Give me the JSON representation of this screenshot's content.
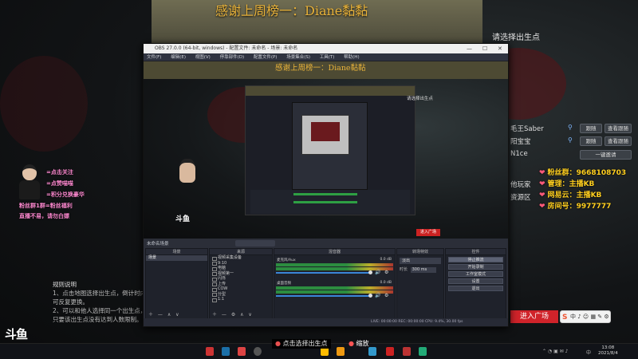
{
  "stream": {
    "banner_title": "感谢上周榜一：Diane黏黏",
    "choose_spawn_hint": "请选择出生点",
    "enter_plaza": "进入广场",
    "platform_logo": "斗鱼",
    "bottom_toast": "点击选择出生点",
    "bottom_toast_2": "缩放"
  },
  "right_panel": {
    "players": [
      {
        "name": "毛王Saber",
        "left_btn": "跟随",
        "right_btn": "查看跟随"
      },
      {
        "name": "阳宝宝",
        "left_btn": "跟随",
        "right_btn": "查看跟随"
      },
      {
        "name": "N1ce",
        "left_btn": "",
        "right_btn": "一键邀请"
      },
      {
        "name": "他玩家",
        "left_btn": "",
        "right_btn": ""
      },
      {
        "name": "资源区",
        "left_btn": "",
        "right_btn": ""
      }
    ],
    "info": [
      {
        "label": "粉丝群：",
        "value": "9668108703"
      },
      {
        "label": "管理：",
        "value": "主播KB"
      },
      {
        "label": "网易云：",
        "value": "主播KB"
      },
      {
        "label": "房间号：",
        "value": "9977777"
      }
    ]
  },
  "left_panel": {
    "lines": [
      "=点击关注",
      "=点赞喵喵",
      "=积分兑换豪华",
      "粉丝群1群=粉丝福利",
      "直播不易，请勿白嫖"
    ],
    "rules_title": "规则说明",
    "rules": [
      "1、点击地图选择出生点，倒计时内",
      "可反复更换。",
      "2、可以和他人选择同一个出生点，",
      "只要该出生点没有达到人数限制。"
    ]
  },
  "obs": {
    "title": "OBS 27.0.0 (64-bit, windows) - 配置文件: 未命名 - 场景: 未命名",
    "menu": [
      "文件(F)",
      "编辑(E)",
      "视图(V)",
      "停靠部件(D)",
      "配置文件(P)",
      "场景集合(S)",
      "工具(T)",
      "帮助(H)"
    ],
    "preview_banner": "感谢上周榜一：Diane黏黏",
    "preview_hint": "请选择出生点",
    "preview_enter": "进入广场",
    "dock_title": "未命名场景",
    "scenes_header": "场景",
    "scenes": [
      "场景"
    ],
    "sources_header": "来源",
    "sources": [
      "视频采集设备",
      "9:10",
      "电脑",
      "视频第一",
      "闪烁",
      "上传",
      "COW",
      "分型",
      "1:1"
    ],
    "mixer_header": "混音器",
    "mixer": [
      {
        "name": "麦克风/Aux",
        "db": "0.0 dB"
      },
      {
        "name": "桌面音频",
        "db": "0.0 dB"
      }
    ],
    "transitions_header": "转场特效",
    "transition_name": "淡出",
    "duration_label": "时长",
    "duration_value": "300 ms",
    "controls_header": "控件",
    "controls": [
      "停止推流",
      "开始录制",
      "工作室模式",
      "设置",
      "退出"
    ],
    "status": "LIVE: 00:00:00    REC: 00:00:00    CPU: 9.4%, 30.00 fps"
  },
  "taskbar": {
    "time": "13:08",
    "date": "2021/8/4",
    "ime": "中"
  }
}
